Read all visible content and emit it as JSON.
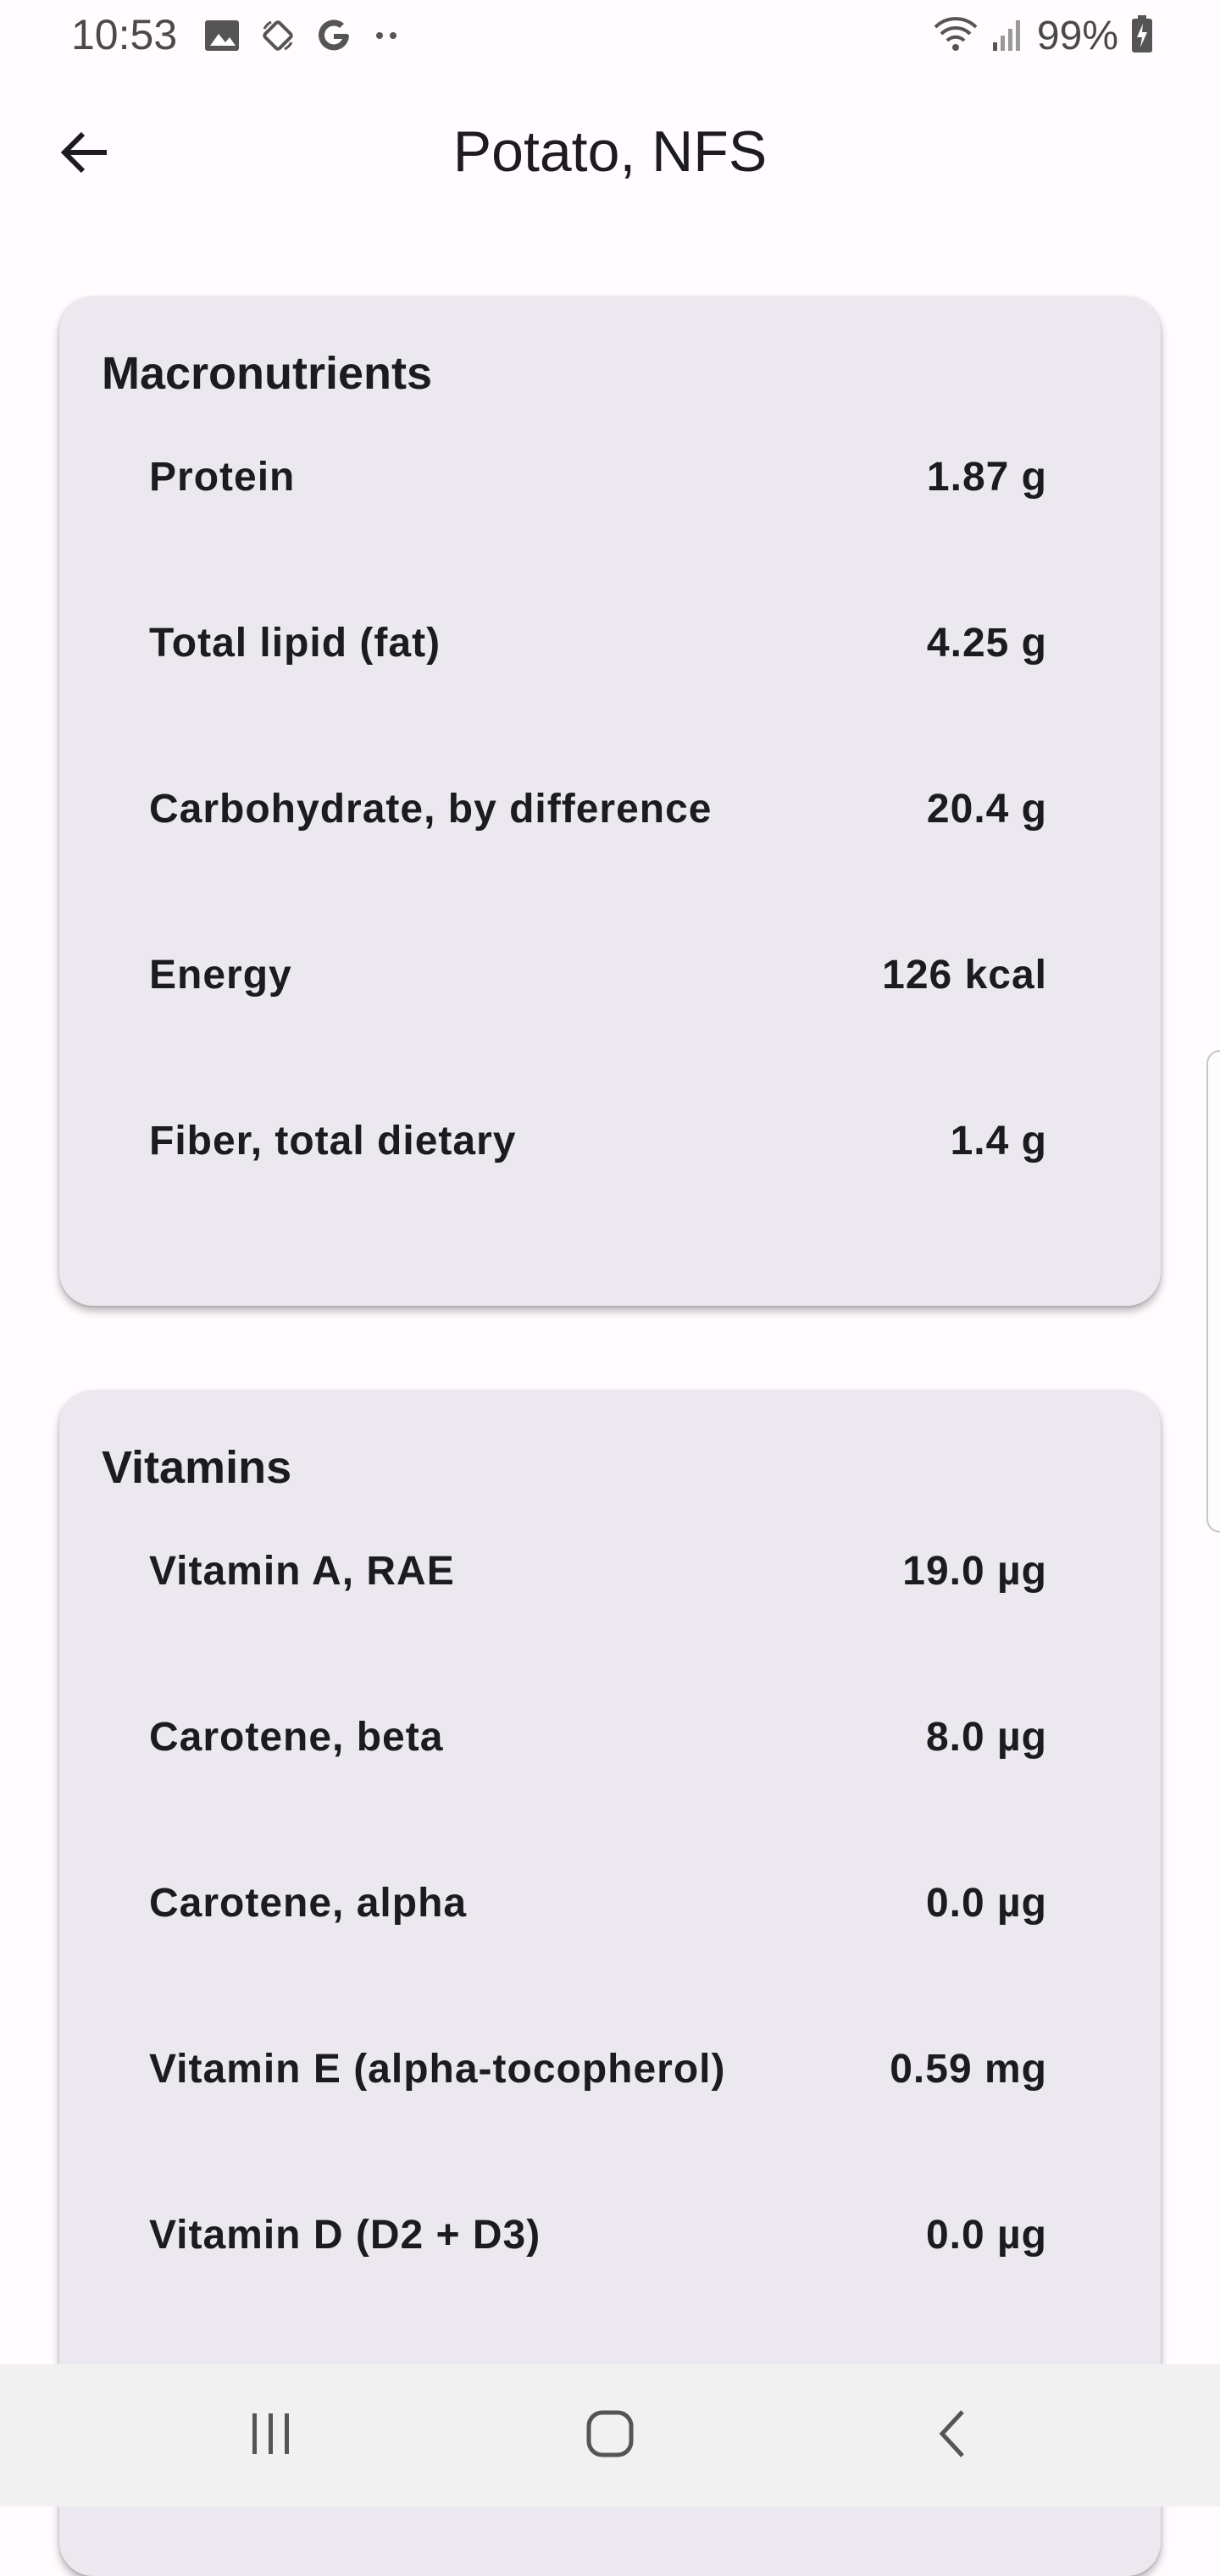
{
  "status_bar": {
    "time": "10:53",
    "battery_percent": "99%",
    "left_icons": [
      "image-icon",
      "rotate-icon",
      "google-icon",
      "more-dots-icon"
    ],
    "right_icons": [
      "wifi-icon",
      "signal-icon",
      "battery-charging-icon"
    ]
  },
  "header": {
    "title": "Potato, NFS",
    "back_icon": "arrow-back-icon"
  },
  "macronutrients": {
    "title": "Macronutrients",
    "items": [
      {
        "name": "Protein",
        "value": "1.87 g"
      },
      {
        "name": "Total lipid (fat)",
        "value": "4.25 g"
      },
      {
        "name": "Carbohydrate, by difference",
        "value": "20.4 g"
      },
      {
        "name": "Energy",
        "value": "126 kcal"
      },
      {
        "name": "Fiber, total dietary",
        "value": "1.4 g"
      }
    ]
  },
  "vitamins": {
    "title": "Vitamins",
    "items": [
      {
        "name": "Vitamin A, RAE",
        "value": "19.0 µg"
      },
      {
        "name": "Carotene, beta",
        "value": "8.0 µg"
      },
      {
        "name": "Carotene, alpha",
        "value": "0.0 µg"
      },
      {
        "name": "Vitamin E (alpha-tocopherol)",
        "value": "0.59 mg"
      },
      {
        "name": "Vitamin D (D2 + D3)",
        "value": "0.0 µg"
      }
    ]
  },
  "nav_bar": {
    "icons": [
      "recents-icon",
      "home-icon",
      "back-icon"
    ]
  },
  "colors": {
    "background": "#fffbfe",
    "card": "#ece8ef",
    "text": "#1c1b1f",
    "nav_bar": "#f2f1f2"
  }
}
